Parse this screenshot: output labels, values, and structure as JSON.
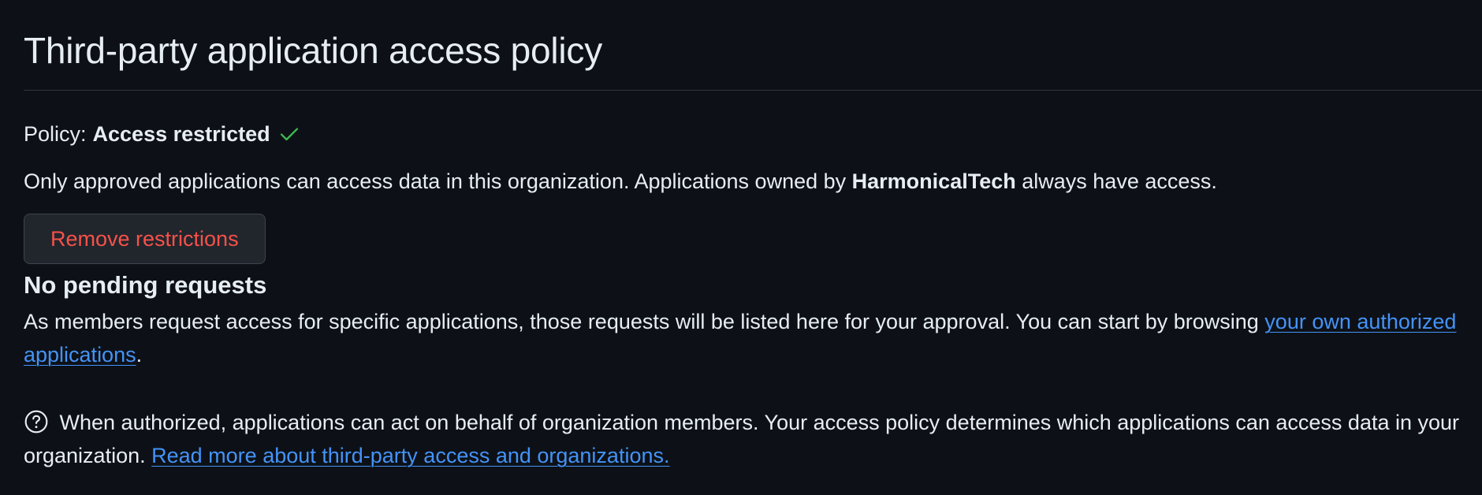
{
  "page": {
    "title": "Third-party application access policy"
  },
  "policy": {
    "label": "Policy:",
    "value": "Access restricted",
    "status_icon": "check-icon",
    "status_color": "#3fb950"
  },
  "description": {
    "before_org": "Only approved applications can access data in this organization. Applications owned by",
    "org_name": "HarmonicalTech",
    "after_org": "always have access."
  },
  "actions": {
    "remove_label": "Remove restrictions",
    "remove_color": "#f85149"
  },
  "pending": {
    "heading": "No pending requests",
    "body_before_link": "As members request access for specific applications, those requests will be listed here for your approval. You can start by browsing",
    "link_text": "your own authorized applications",
    "body_after_link": "."
  },
  "note": {
    "icon": "question-circle-icon",
    "text": "When authorized, applications can act on behalf of organization members. Your access policy determines which applications can access data in your organization.",
    "link_text": "Read more about third-party access and organizations."
  },
  "colors": {
    "background": "#0d1117",
    "text": "#e6edf3",
    "link": "#4493f8",
    "border": "#30363d"
  }
}
